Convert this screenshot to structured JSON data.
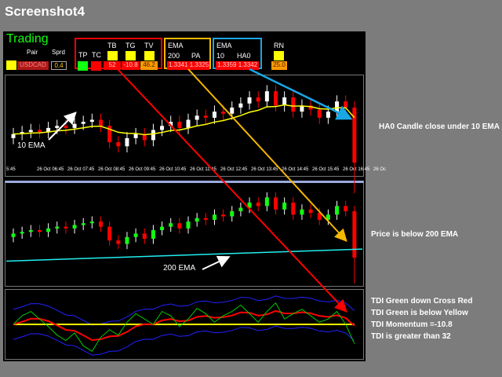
{
  "title": "Screenshot4",
  "infobar": {
    "trading": "Trading",
    "pair_label": "Pair",
    "pair": "USDCAD",
    "sprd_label": "Sprd",
    "sprd": "0.4",
    "tp": "TP",
    "tc": "TC",
    "tb": "TB",
    "tg": "TG",
    "tv": "TV",
    "tb_val": "52",
    "tg_val": "-10.8",
    "tv_val": "46.2",
    "ema200_l1": "EMA",
    "ema200_l2": "200",
    "pa": "PA",
    "ema200_val": "1.3341",
    "pa_val": "1.3325",
    "ema10_l1": "EMA",
    "ema10_l2": "10",
    "ha0": "HA0",
    "ema10_val": "1.3359",
    "ha0_val": "1.3342",
    "rn": "RN",
    "rn_val": "25.0"
  },
  "time_ticks": [
    "5:45",
    "26 Oct 06:45",
    "26 Oct 07:45",
    "26 Oct 08:45",
    "26 Oct 09:45",
    "26 Oct 10:45",
    "26 Oct 11:45",
    "26 Oct 12:45",
    "26 Oct 13:45",
    "26 Oct 14:45",
    "26 Oct 15:45",
    "26 Oct 16:45",
    "26 Oc"
  ],
  "labels": {
    "ema10": "10 EMA",
    "ema200": "200 EMA"
  },
  "annotations": [
    "HA0 Candle close under 10 EMA",
    "Price is below 200 EMA",
    "TDI Green down Cross Red",
    "TDI Green is below Yellow",
    "TDI Momentum =-10.8",
    "TDI is greater than 32"
  ],
  "colors": {
    "red": "#ff1a1a",
    "yellow": "#ffd400",
    "blue": "#1aa7e6",
    "green": "#00ff00"
  },
  "chart_data": {
    "type": "candlestick",
    "closes": [
      1.3344,
      1.3345,
      1.3346,
      1.3345,
      1.3347,
      1.3348,
      1.3347,
      1.3349,
      1.335,
      1.3351,
      1.3348,
      1.334,
      1.3338,
      1.3342,
      1.3344,
      1.3341,
      1.3346,
      1.3348,
      1.335,
      1.3347,
      1.3351,
      1.3353,
      1.3352,
      1.3355,
      1.3354,
      1.3357,
      1.3359,
      1.3362,
      1.336,
      1.3365,
      1.3358,
      1.3362,
      1.3355,
      1.3358,
      1.3356,
      1.3352,
      1.3355,
      1.336,
      1.3357,
      1.333
    ],
    "ema200": [
      1.3328,
      1.3335
    ],
    "tdi_green": [
      50,
      58,
      62,
      55,
      48,
      40,
      35,
      42,
      30,
      25,
      38,
      45,
      40,
      52,
      60,
      55,
      50,
      62,
      58,
      48,
      55,
      65,
      60,
      52,
      58,
      62,
      68,
      60,
      52,
      62,
      70,
      55,
      60,
      64,
      58,
      52,
      55,
      62,
      50,
      32
    ]
  }
}
